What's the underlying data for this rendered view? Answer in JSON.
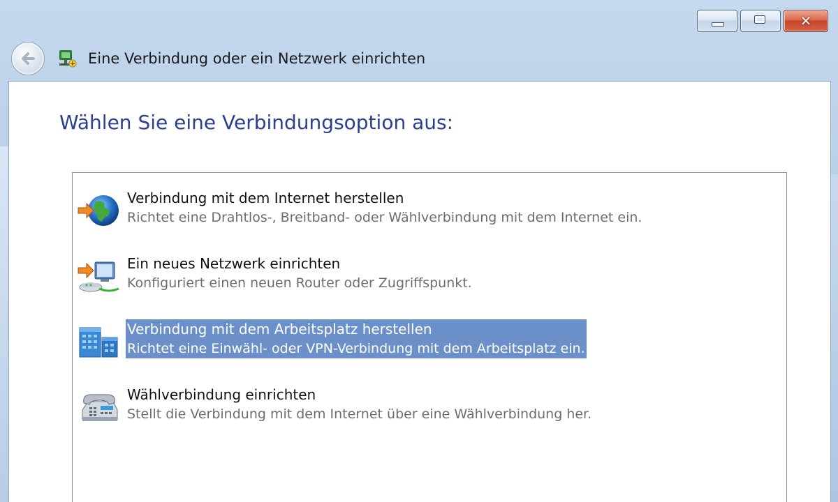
{
  "window": {
    "title": "Eine Verbindung oder ein Netzwerk einrichten",
    "caption_buttons": {
      "minimize_icon": "minimize-icon",
      "maximize_icon": "maximize-icon",
      "close_glyph": "✕"
    }
  },
  "nav": {
    "back_icon": "back-arrow-icon",
    "window_icon": "network-setup-icon"
  },
  "content": {
    "instruction": "Wählen Sie eine Verbindungsoption aus:",
    "options": [
      {
        "title": "Verbindung mit dem Internet herstellen",
        "description": "Richtet eine Drahtlos-, Breitband- oder Wählverbindung mit dem Internet ein.",
        "icon": "globe-icon",
        "selected": false
      },
      {
        "title": "Ein neues Netzwerk einrichten",
        "description": "Konfiguriert einen neuen Router oder Zugriffspunkt.",
        "icon": "router-network-icon",
        "selected": false
      },
      {
        "title": "Verbindung mit dem Arbeitsplatz herstellen",
        "description": "Richtet eine Einwähl- oder VPN-Verbindung mit dem Arbeitsplatz ein.",
        "icon": "workplace-building-icon",
        "selected": true
      },
      {
        "title": "Wählverbindung einrichten",
        "description": "Stellt die Verbindung mit dem Internet über eine Wählverbindung her.",
        "icon": "telephone-icon",
        "selected": false
      }
    ]
  },
  "colors": {
    "selection": "#6b8fc8",
    "instruction_text": "#2a3f8e",
    "frame": "#b7cde6"
  }
}
